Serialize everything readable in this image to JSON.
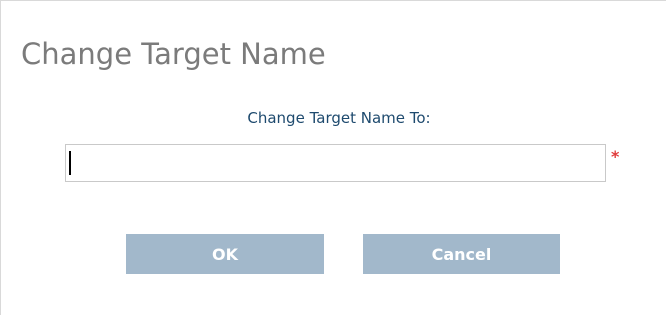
{
  "dialog": {
    "title": "Change Target Name",
    "field_label": "Change Target Name To:",
    "input_value": "",
    "required_marker": "*",
    "ok_label": "OK",
    "cancel_label": "Cancel"
  },
  "colors": {
    "title": "#7b7b7b",
    "label": "#1e4a6e",
    "button_bg": "#a2b8cb",
    "required": "#e03b3b"
  }
}
